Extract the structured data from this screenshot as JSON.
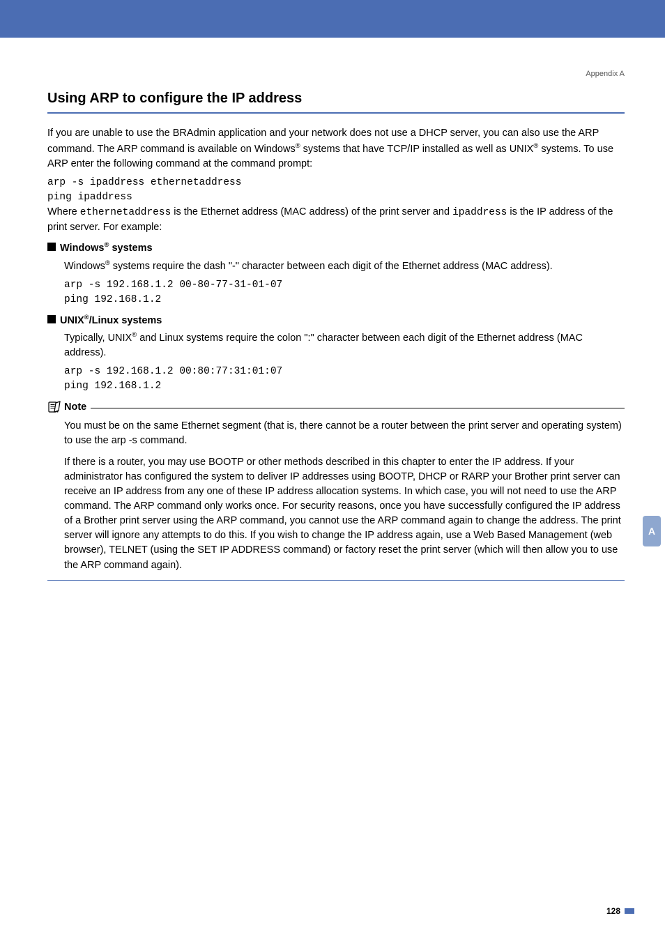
{
  "header": {
    "appendix": "Appendix A"
  },
  "section": {
    "heading": "Using ARP to configure the IP address"
  },
  "intro": {
    "p1a": "If you are unable to use the BRAdmin application and your network does not use a DHCP server, you can also use the ARP command. The ARP command is available on Windows",
    "p1b": " systems that have TCP/IP installed as well as UNIX",
    "p1c": " systems. To use ARP enter the following command at the command prompt:",
    "cmd1": "arp -s ipaddress ethernetaddress",
    "cmd2": "ping ipaddress",
    "p2a": "Where ",
    "p2code1": "ethernetaddress",
    "p2b": " is the Ethernet address (MAC address) of the print server and ",
    "p2code2": "ipaddress",
    "p2c": " is the IP address of the print server. For example:"
  },
  "windows": {
    "label_a": "Windows",
    "label_b": " systems",
    "body_a": "Windows",
    "body_b": " systems require the dash \"-\" character between each digit of the Ethernet address (MAC address).",
    "cmd1": "arp -s 192.168.1.2 00-80-77-31-01-07",
    "cmd2": "ping 192.168.1.2"
  },
  "unix": {
    "label_a": "UNIX",
    "label_b": "/Linux systems",
    "body_a": "Typically, UNIX",
    "body_b": " and Linux systems require the colon \":\" character between each digit of the Ethernet address (MAC address).",
    "cmd1": "arp -s 192.168.1.2 00:80:77:31:01:07",
    "cmd2": "ping 192.168.1.2"
  },
  "note": {
    "label": "Note",
    "p1": "You must be on the same Ethernet segment (that is, there cannot be a router between the print server and operating system) to use the arp -s command.",
    "p2": "If there is a router, you may use BOOTP or other methods described in this chapter to enter the IP address. If your administrator has configured the system to deliver IP addresses using BOOTP, DHCP or RARP your Brother print server can receive an IP address from any one of these IP address allocation systems. In which case, you will not need to use the ARP command. The ARP command only works once. For security reasons, once you have successfully configured the IP address of a Brother print server using the ARP command, you cannot use the ARP command again to change the address. The print server will ignore any attempts to do this. If you wish to change the IP address again, use a Web Based Management (web browser), TELNET (using the SET IP ADDRESS command) or factory reset the print server (which will then allow you to use the ARP command again)."
  },
  "sidetab": {
    "label": "A"
  },
  "footer": {
    "page": "128"
  },
  "glyphs": {
    "reg": "®"
  }
}
